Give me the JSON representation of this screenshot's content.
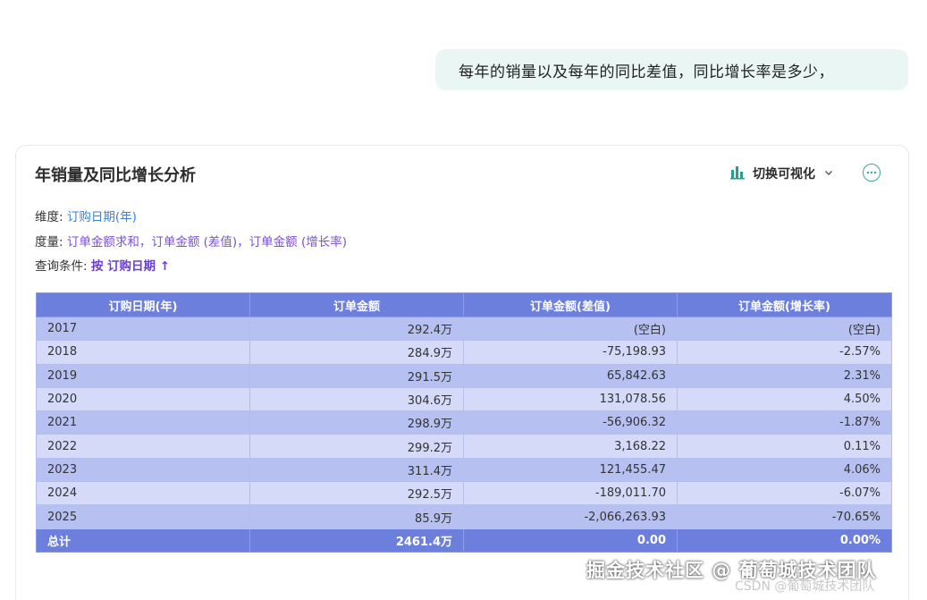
{
  "chat": {
    "question": "每年的销量以及每年的同比差值，同比增长率是多少，"
  },
  "card": {
    "title": "年销量及同比增长分析",
    "switch_label": "切换可视化",
    "icons": {
      "chart": "bar-chart-icon",
      "chevron": "chevron-down-icon",
      "more": "more-icon"
    },
    "dimension_label": "维度:",
    "dimension_value": "订购日期(年)",
    "measure_label": "度量:",
    "measure_value": "订单金额求和，订单金额 (差值)，订单金额 (增长率)",
    "condition_label": "查询条件:",
    "condition_value": "按 订购日期 ↑"
  },
  "table": {
    "headers": [
      "订购日期(年)",
      "订单金额",
      "订单金额(差值)",
      "订单金额(增长率)"
    ],
    "rows": [
      [
        "2017",
        "292.4万",
        "(空白)",
        "(空白)"
      ],
      [
        "2018",
        "284.9万",
        "-75,198.93",
        "-2.57%"
      ],
      [
        "2019",
        "291.5万",
        "65,842.63",
        "2.31%"
      ],
      [
        "2020",
        "304.6万",
        "131,078.56",
        "4.50%"
      ],
      [
        "2021",
        "298.9万",
        "-56,906.32",
        "-1.87%"
      ],
      [
        "2022",
        "299.2万",
        "3,168.22",
        "0.11%"
      ],
      [
        "2023",
        "311.4万",
        "121,455.47",
        "4.06%"
      ],
      [
        "2024",
        "292.5万",
        "-189,011.70",
        "-6.07%"
      ],
      [
        "2025",
        "85.9万",
        "-2,066,263.93",
        "-70.65%"
      ]
    ],
    "total": [
      "总计",
      "2461.4万",
      "0.00",
      "0.00%"
    ]
  },
  "watermark": {
    "line1": "掘金技术社区 @ 葡萄城技术团队",
    "line2": "CSDN @葡萄城技术团队"
  },
  "colors": {
    "header": "#6d7fdc",
    "row_odd": "#b7c1f1",
    "row_even": "#d4daf8",
    "accent": "#3aa89a",
    "bubble": "#eaf6f3"
  }
}
